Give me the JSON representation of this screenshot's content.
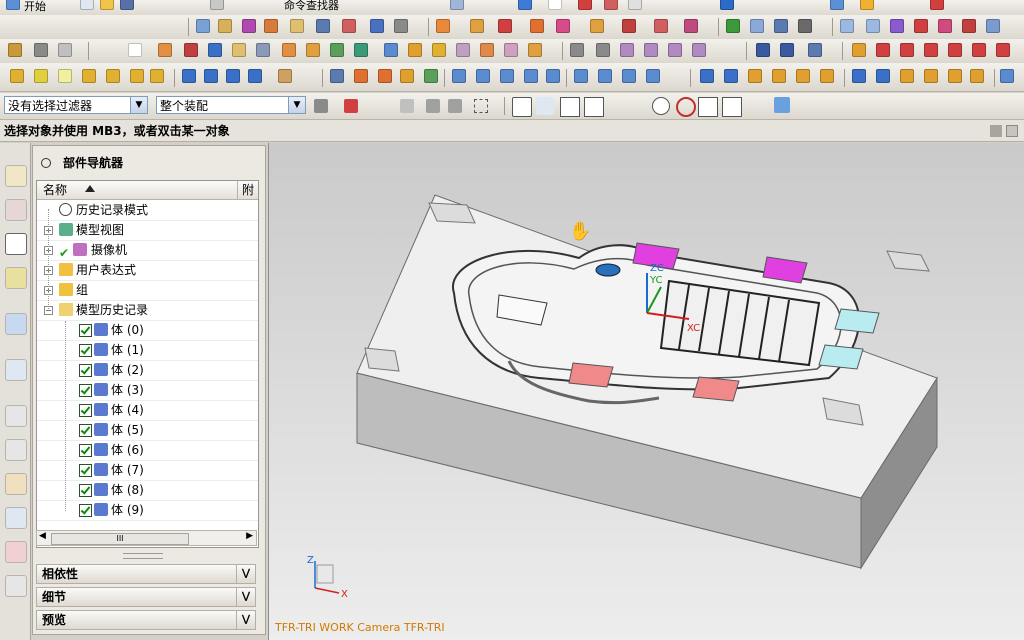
{
  "menu": {
    "start_label": "开始",
    "command_search": "命令查找器"
  },
  "filter": {
    "selection_filter": "没有选择过滤器",
    "assembly_scope": "整个装配"
  },
  "status": {
    "prompt": "选择对象并使用 MB3，或者双击某一对象"
  },
  "navigator": {
    "title": "部件导航器",
    "col_name": "名称",
    "col_attached": "附",
    "nodes": [
      {
        "label": "历史记录模式",
        "icon": "clock-icon"
      },
      {
        "label": "模型视图",
        "icon": "model-view-icon"
      },
      {
        "label": "摄像机",
        "icon": "camera-icon"
      },
      {
        "label": "用户表达式",
        "icon": "folder-icon"
      },
      {
        "label": "组",
        "icon": "folder-icon"
      },
      {
        "label": "模型历史记录",
        "icon": "folder-open-icon"
      }
    ],
    "bodies": [
      "体 (0)",
      "体 (1)",
      "体 (2)",
      "体 (3)",
      "体 (4)",
      "体 (5)",
      "体 (6)",
      "体 (7)",
      "体 (8)",
      "体 (9)"
    ],
    "scroll_thumb": "III",
    "sections": [
      "相依性",
      "细节",
      "预览"
    ]
  },
  "viewport": {
    "camera_label": "TFR-TRI WORK Camera TFR-TRI",
    "triad": {
      "z": "Z",
      "x": "X"
    },
    "wcs": {
      "zc": "ZC",
      "yc": "YC",
      "xc": "XC"
    }
  },
  "colors": {
    "accent_magenta": "#e040e0",
    "pad_pink": "#f08a8a",
    "pad_cyan": "#b9ecf0",
    "camera_text": "#d07a00"
  }
}
